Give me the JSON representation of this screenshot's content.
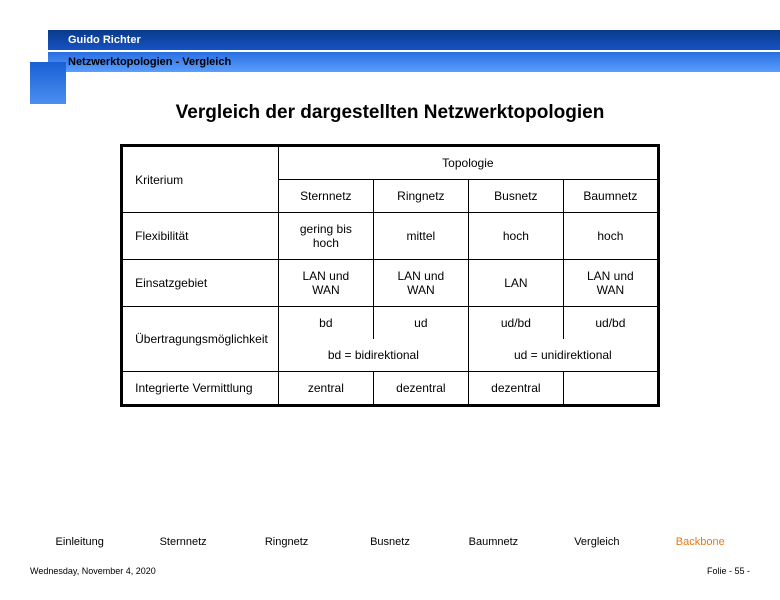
{
  "header": {
    "author": "Guido Richter",
    "breadcrumb": "Netzwerktopologien  - Vergleich"
  },
  "title": "Vergleich der dargestellten Netzwerktopologien",
  "table": {
    "criterion_label": "Kriterium",
    "topology_label": "Topologie",
    "cols": [
      "Sternnetz",
      "Ringnetz",
      "Busnetz",
      "Baumnetz"
    ],
    "rows": {
      "flex": {
        "label": "Flexibilität",
        "vals": [
          "gering bis hoch",
          "mittel",
          "hoch",
          "hoch"
        ]
      },
      "einsatz": {
        "label": "Einsatzgebiet",
        "vals": [
          "LAN und WAN",
          "LAN und WAN",
          "LAN",
          "LAN und WAN"
        ]
      },
      "uebertrag": {
        "label": "Übertragungsmöglichkeit",
        "vals": [
          "bd",
          "ud",
          "ud/bd",
          "ud/bd"
        ]
      },
      "legend": {
        "bd": "bd = bidirektional",
        "ud": "ud = unidirektional"
      },
      "integ": {
        "label": "Integrierte Vermittlung",
        "vals": [
          "zentral",
          "dezentral",
          "dezentral",
          ""
        ]
      }
    }
  },
  "nav": [
    "Einleitung",
    "Sternnetz",
    "Ringnetz",
    "Busnetz",
    "Baumnetz",
    "Vergleich",
    "Backbone"
  ],
  "footer": {
    "date": "Wednesday, November 4, 2020",
    "page": "Folie - 55 -"
  }
}
